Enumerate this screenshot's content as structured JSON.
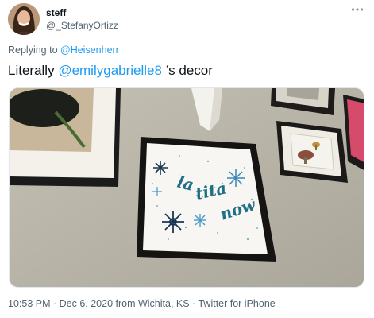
{
  "user": {
    "display_name": "steff",
    "handle": "@_StefanyOrtizz"
  },
  "more_icon": "more-horizontal-icon",
  "reply": {
    "prefix": "Replying to ",
    "mention": "@Heisenherr"
  },
  "tweet": {
    "text_before": "Literally ",
    "mention": "@emilygabrielle8",
    "text_after": " ’s decor"
  },
  "photo": {
    "frame_words": [
      "la",
      "tita",
      "now"
    ]
  },
  "meta": {
    "time": "10:53 PM",
    "separator": " · ",
    "date_location": "Dec 6, 2020 from Wichita, KS",
    "source": "Twitter for iPhone"
  },
  "colors": {
    "link": "#1d9bf0",
    "secondary_text": "#536471",
    "frame_ink": "#1f6e86"
  }
}
